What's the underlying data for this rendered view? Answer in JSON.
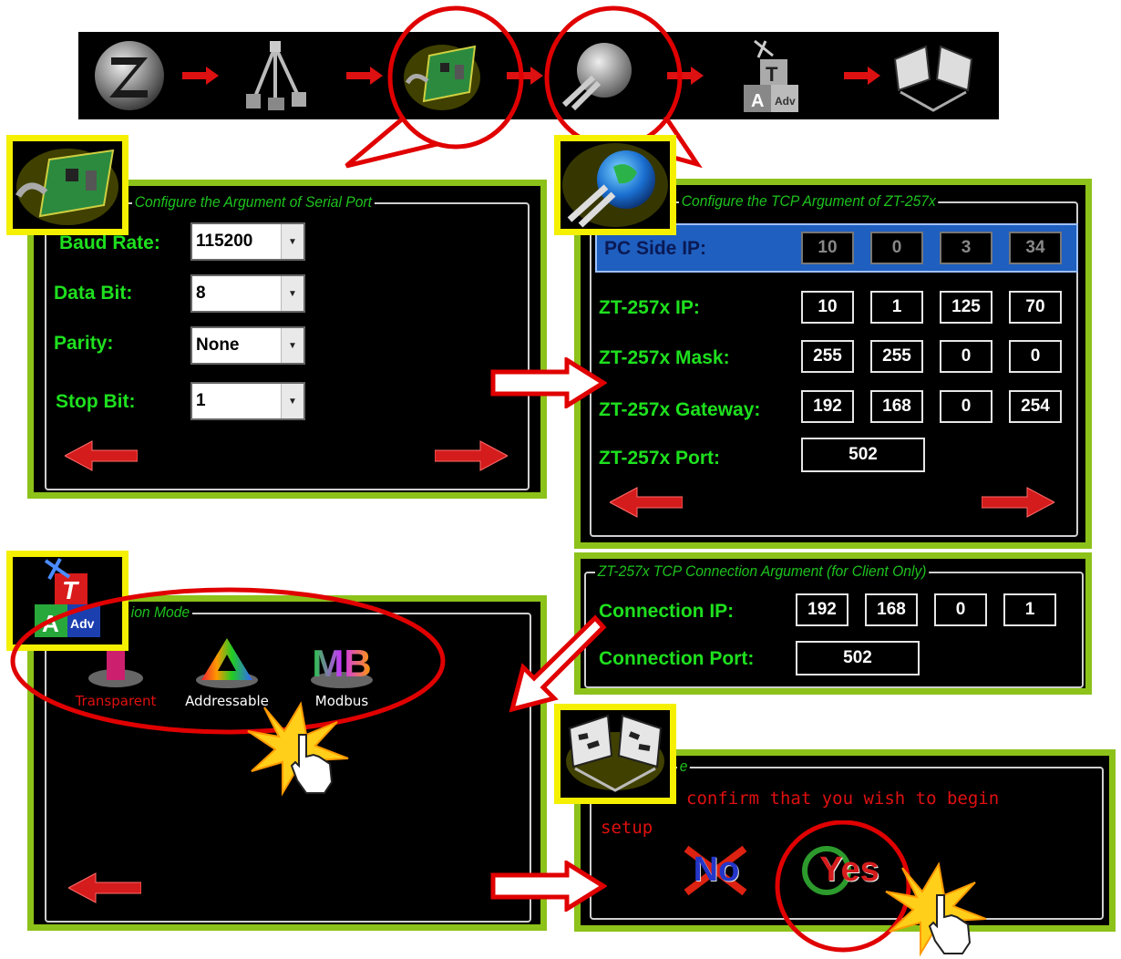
{
  "wizard": {
    "steps": [
      "zt-logo",
      "cables",
      "serial-card",
      "network-globe",
      "mode",
      "finish-flags"
    ]
  },
  "serial_panel": {
    "legend": "Configure the Argument of Serial Port",
    "baud_rate_label": "Baud Rate:",
    "baud_rate_value": "115200",
    "data_bit_label": "Data Bit:",
    "data_bit_value": "8",
    "parity_label": "Parity:",
    "parity_value": "None",
    "stop_bit_label": "Stop Bit:",
    "stop_bit_value": "1"
  },
  "tcp_panel": {
    "legend": "Configure the TCP Argument of ZT-257x",
    "pc_ip_label": "PC Side IP:",
    "pc_ip": [
      "10",
      "0",
      "3",
      "34"
    ],
    "zt_ip_label": "ZT-257x IP:",
    "zt_ip": [
      "10",
      "1",
      "125",
      "70"
    ],
    "zt_mask_label": "ZT-257x Mask:",
    "zt_mask": [
      "255",
      "255",
      "0",
      "0"
    ],
    "zt_gateway_label": "ZT-257x Gateway:",
    "zt_gateway": [
      "192",
      "168",
      "0",
      "254"
    ],
    "zt_port_label": "ZT-257x Port:",
    "zt_port": "502"
  },
  "client_panel": {
    "legend": "ZT-257x TCP Connection Argument (for Client Only)",
    "conn_ip_label": "Connection IP:",
    "conn_ip": [
      "192",
      "168",
      "0",
      "1"
    ],
    "conn_port_label": "Connection Port:",
    "conn_port": "502"
  },
  "mode_panel": {
    "legend": "ion Mode",
    "modes": [
      "Transparent",
      "Addressable",
      "Modbus"
    ]
  },
  "confirm_panel": {
    "legend": "e",
    "message_line1": "confirm that you wish to begin",
    "message_line2": "setup",
    "no_label": "No",
    "yes_label": "Yes"
  },
  "colors": {
    "panel_border": "#8cc21a",
    "label_green": "#1ee01e",
    "highlight_red": "#e00000",
    "icon_frame_yellow": "#f4f000",
    "pc_ip_bar": "#1f5fbf"
  }
}
